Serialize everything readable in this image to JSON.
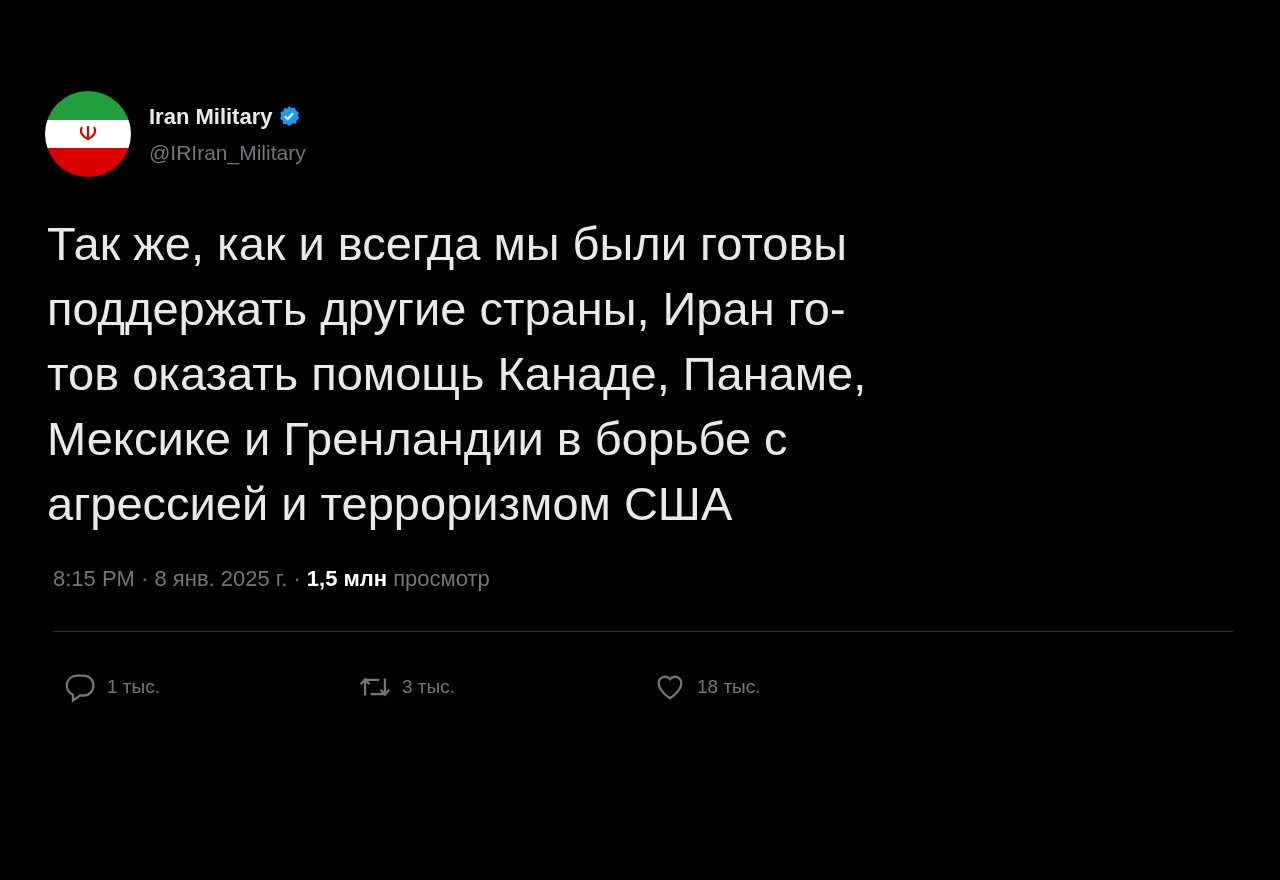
{
  "author": {
    "name": "Iran Military",
    "verified": true,
    "handle": "@IRIran_Military"
  },
  "body_lines": [
    "Так же, как и всегда мы были готовы",
    "поддержать другие страны, Иран го-",
    "тов оказать помощь Канаде, Панаме,",
    "Мексике и Гренландии в борьбе с",
    "агрессией и терроризмом США"
  ],
  "meta": "8:15 PM · 8 янв. 2025 г. · **1,5 млн** просмотр",
  "actions": [
    {
      "kind": "reply",
      "count": "1 тыс."
    },
    {
      "kind": "retweet",
      "count": "3 тыс."
    },
    {
      "kind": "like",
      "count": "18 тыс."
    }
  ]
}
